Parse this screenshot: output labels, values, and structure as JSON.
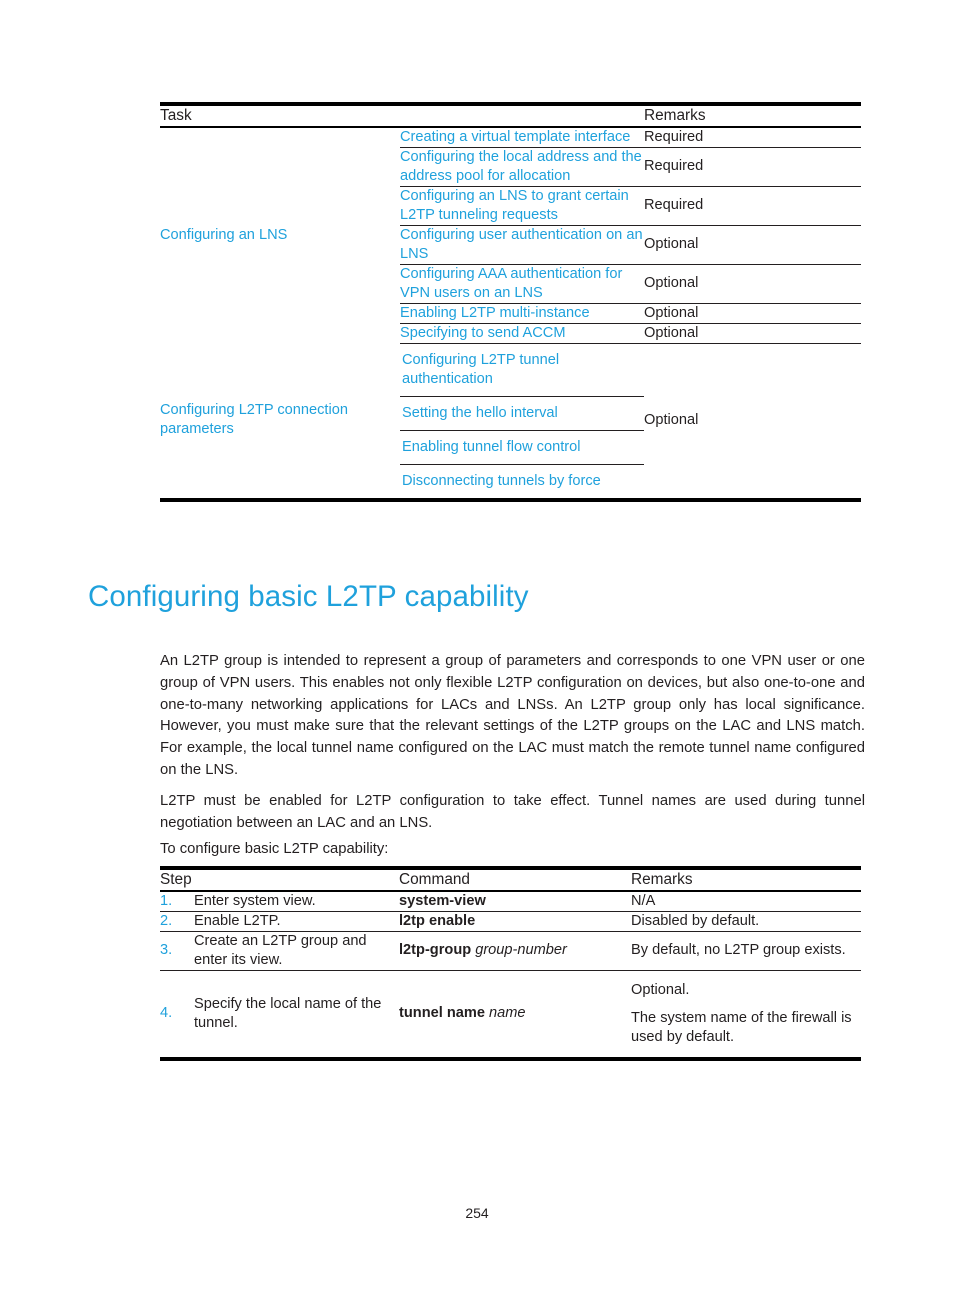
{
  "page": {
    "number": "254"
  },
  "task_table": {
    "headers": {
      "task": "Task",
      "remarks": "Remarks"
    },
    "groups": [
      {
        "task": "Configuring an LNS",
        "rows": [
          {
            "item": "Creating a virtual template interface",
            "remark": "Required"
          },
          {
            "item": "Configuring the local address and the address pool for allocation",
            "remark": "Required"
          },
          {
            "item": "Configuring an LNS to grant certain L2TP tunneling requests",
            "remark": "Required"
          },
          {
            "item": "Configuring user authentication on an LNS",
            "remark": "Optional"
          },
          {
            "item": "Configuring AAA authentication for VPN users on an LNS",
            "remark": "Optional"
          },
          {
            "item": "Enabling L2TP multi-instance",
            "remark": "Optional"
          },
          {
            "item": "Specifying to send ACCM",
            "remark": "Optional"
          }
        ]
      },
      {
        "task": "Configuring L2TP connection parameters",
        "shared_remark": "Optional",
        "rows": [
          {
            "item": "Configuring L2TP tunnel authentication"
          },
          {
            "item": "Setting the hello interval"
          },
          {
            "item": "Enabling tunnel flow control"
          },
          {
            "item": "Disconnecting tunnels by force"
          }
        ]
      }
    ]
  },
  "section": {
    "title": "Configuring basic L2TP capability",
    "paragraphs": [
      "An L2TP group is intended to represent a group of parameters and corresponds to one VPN user or one group of VPN users. This enables not only flexible L2TP configuration on devices, but also one-to-one and one-to-many networking applications for LACs and LNSs. An L2TP group only has local significance. However, you must make sure that the relevant settings of the L2TP groups on the LAC and LNS match. For example, the local tunnel name configured on the LAC must match the remote tunnel name configured on the LNS.",
      "L2TP must be enabled for L2TP configuration to take effect. Tunnel names are used during tunnel negotiation between an LAC and an LNS.",
      "To configure basic L2TP capability:"
    ]
  },
  "step_table": {
    "headers": {
      "step": "Step",
      "command": "Command",
      "remarks": "Remarks"
    },
    "rows": [
      {
        "num": "1.",
        "step": "Enter system view.",
        "command": "system-view",
        "command_arg": "",
        "remarks": [
          "N/A"
        ]
      },
      {
        "num": "2.",
        "step": "Enable L2TP.",
        "command": "l2tp enable",
        "command_arg": "",
        "remarks": [
          "Disabled by default."
        ]
      },
      {
        "num": "3.",
        "step": "Create an L2TP group and enter its view.",
        "command": "l2tp-group",
        "command_arg": "group-number",
        "remarks": [
          "By default, no L2TP group exists."
        ]
      },
      {
        "num": "4.",
        "step": "Specify the local name of the tunnel.",
        "command": "tunnel name",
        "command_arg": "name",
        "remarks": [
          "Optional.",
          "The system name of the firewall is used by default."
        ]
      }
    ]
  },
  "colors": {
    "accent_blue": "#1fa1dc",
    "text": "#231f20"
  }
}
